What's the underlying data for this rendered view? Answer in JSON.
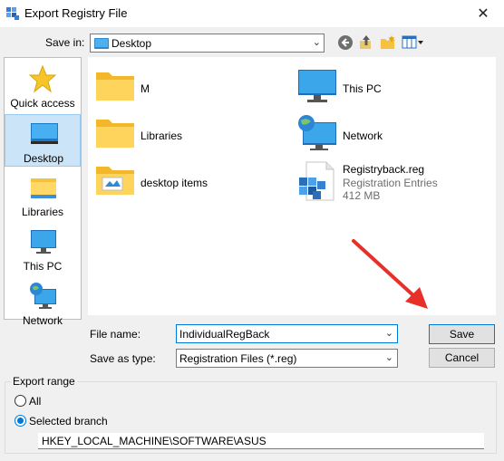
{
  "window": {
    "title": "Export Registry File",
    "close_glyph": "✕"
  },
  "toolbar": {
    "save_in_label": "Save in:",
    "save_in_value": "Desktop",
    "icons": [
      "back-icon",
      "up-folder-icon",
      "new-folder-icon",
      "view-menu-icon"
    ]
  },
  "places": [
    {
      "label": "Quick access",
      "icon": "star-icon"
    },
    {
      "label": "Desktop",
      "icon": "desktop-icon",
      "selected": true
    },
    {
      "label": "Libraries",
      "icon": "libraries-icon"
    },
    {
      "label": "This PC",
      "icon": "this-pc-icon"
    },
    {
      "label": "Network",
      "icon": "network-icon"
    }
  ],
  "files": {
    "m": {
      "name": "M"
    },
    "libraries": {
      "name": "Libraries"
    },
    "desktop_items": {
      "name": "desktop items"
    },
    "this_pc": {
      "name": "This PC"
    },
    "network": {
      "name": "Network"
    },
    "registry_file": {
      "name": "Registryback.reg",
      "type": "Registration Entries",
      "size": "412 MB"
    }
  },
  "form": {
    "file_name_label": "File name:",
    "file_name_value": "IndividualRegBack",
    "save_as_type_label": "Save as type:",
    "save_as_type_value": "Registration Files (*.reg)"
  },
  "buttons": {
    "save": "Save",
    "cancel": "Cancel"
  },
  "export_range": {
    "legend": "Export range",
    "all_label": "All",
    "selected_branch_label": "Selected branch",
    "selected": "selected_branch",
    "branch_value": "HKEY_LOCAL_MACHINE\\SOFTWARE\\ASUS"
  },
  "colors": {
    "accent": "#0078d7",
    "annotation_arrow": "#e8302a",
    "folder": "#ffc83d"
  }
}
